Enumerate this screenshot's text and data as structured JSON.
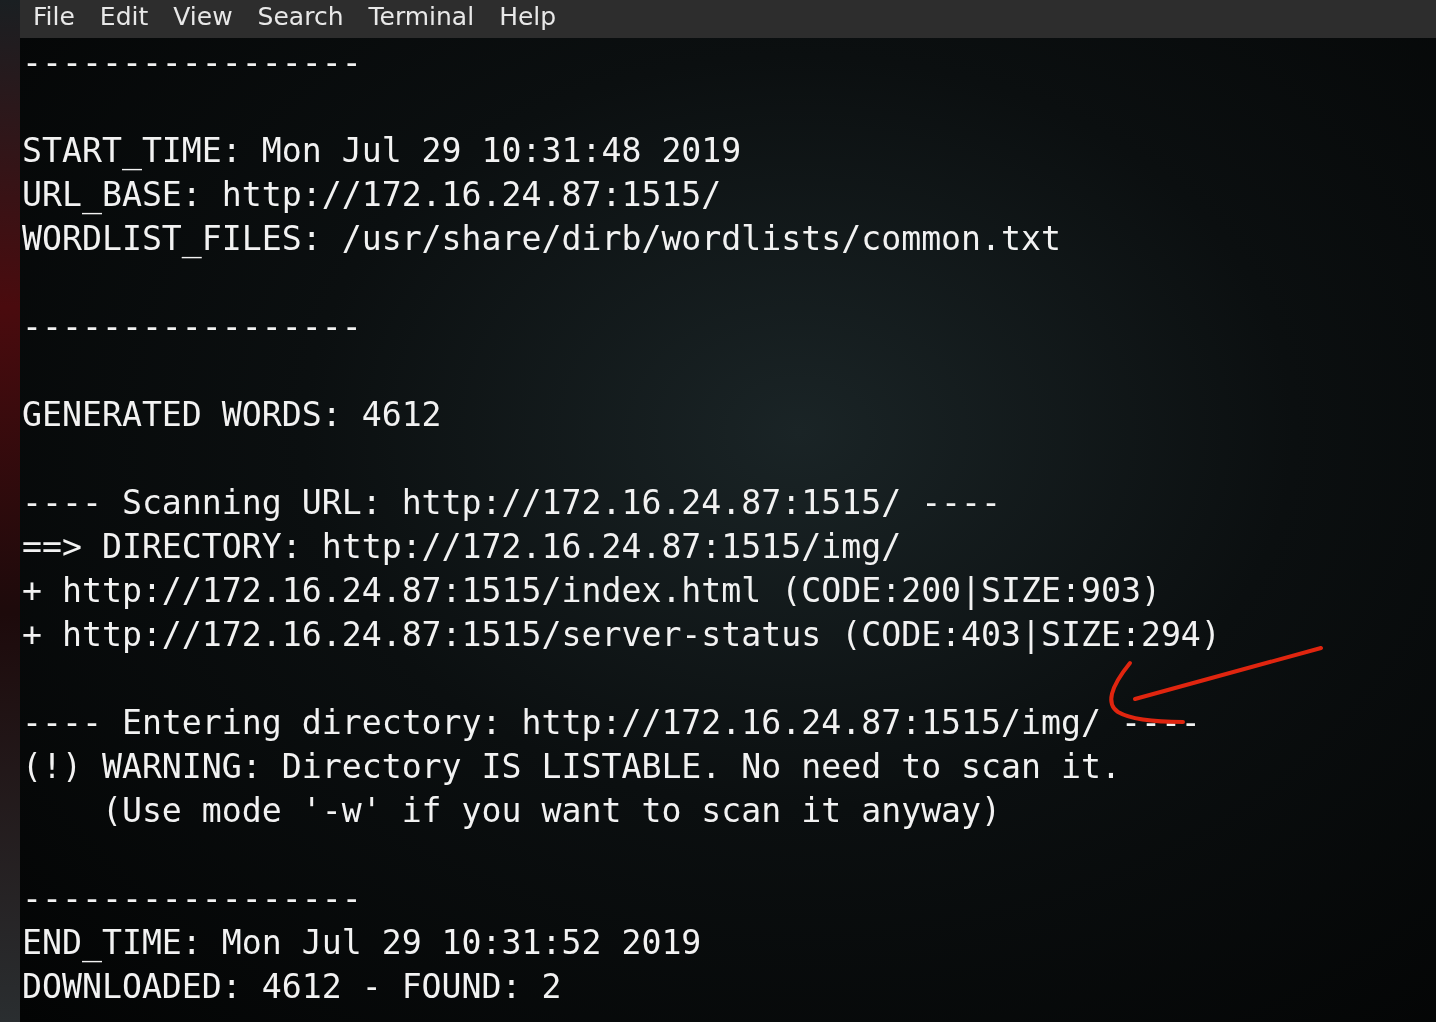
{
  "menu_bar": [
    "File",
    "Edit",
    "View",
    "Search",
    "Terminal",
    "Help"
  ],
  "terminal_blocks": [
    [
      "-----------------"
    ],
    [
      "START_TIME: Mon Jul 29 10:31:48 2019",
      "URL_BASE: http://172.16.24.87:1515/",
      "WORDLIST_FILES: /usr/share/dirb/wordlists/common.txt"
    ],
    [
      "-----------------"
    ],
    [
      "GENERATED WORDS: 4612"
    ],
    [
      "---- Scanning URL: http://172.16.24.87:1515/ ----",
      "==> DIRECTORY: http://172.16.24.87:1515/img/",
      "+ http://172.16.24.87:1515/index.html (CODE:200|SIZE:903)",
      "+ http://172.16.24.87:1515/server-status (CODE:403|SIZE:294)"
    ],
    [
      "---- Entering directory: http://172.16.24.87:1515/img/ ----",
      "(!) WARNING: Directory IS LISTABLE. No need to scan it.",
      "    (Use mode '-w' if you want to scan it anyway)"
    ],
    [
      "-----------------",
      "END_TIME: Mon Jul 29 10:31:52 2019",
      "DOWNLOADED: 4612 - FOUND: 2"
    ]
  ]
}
